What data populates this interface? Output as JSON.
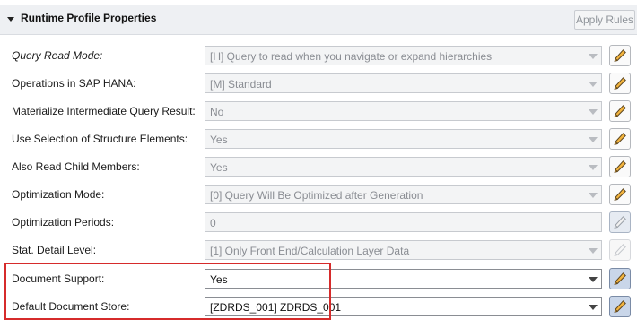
{
  "panel": {
    "title": "Runtime Profile Properties",
    "apply_button": "Apply Rules"
  },
  "rows": [
    {
      "label": "Query Read Mode:",
      "value": "[H] Query to read when you navigate or expand hierarchies"
    },
    {
      "label": "Operations in SAP HANA:",
      "value": "[M] Standard"
    },
    {
      "label": "Materialize Intermediate Query Result:",
      "value": "No"
    },
    {
      "label": "Use Selection of Structure Elements:",
      "value": "Yes"
    },
    {
      "label": "Also Read Child Members:",
      "value": "Yes"
    },
    {
      "label": "Optimization Mode:",
      "value": "[0] Query Will Be Optimized after Generation"
    },
    {
      "label": "Optimization Periods:",
      "value": "0"
    },
    {
      "label": "Stat. Detail Level:",
      "value": "[1] Only Front End/Calculation Layer Data"
    },
    {
      "label": "Document Support:",
      "value": "Yes"
    },
    {
      "label": "Default Document Store:",
      "value": "[ZDRDS_001] ZDRDS_001"
    }
  ],
  "icons": {
    "collapse": "triangle-down-icon",
    "edit": "pencil-icon",
    "dropdown": "chevron-down-icon"
  },
  "colors": {
    "highlight_border": "#d62b2b",
    "pencil_body": "#f2b33d",
    "active_edit_bg": "#c9d6e9"
  }
}
